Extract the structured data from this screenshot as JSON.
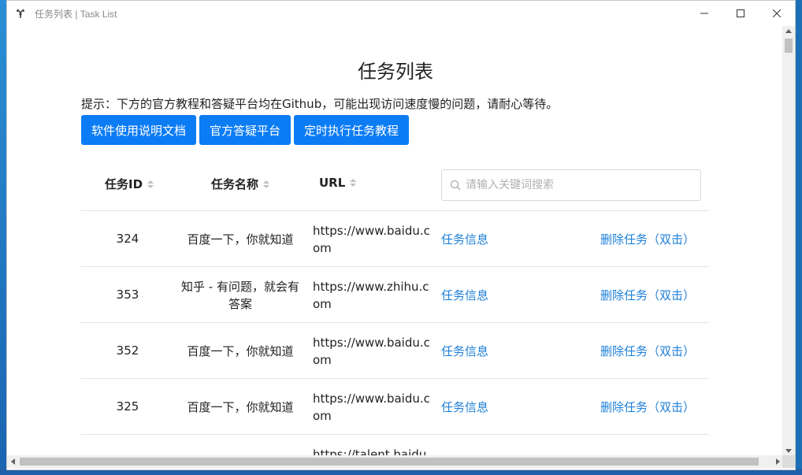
{
  "window": {
    "title": "任务列表 | Task List"
  },
  "page": {
    "title": "任务列表",
    "tip": "提示：下方的官方教程和答疑平台均在Github，可能出现访问速度慢的问题，请耐心等待。",
    "buttons": [
      {
        "label": "软件使用说明文档"
      },
      {
        "label": "官方答疑平台"
      },
      {
        "label": "定时执行任务教程"
      }
    ]
  },
  "table": {
    "columns": {
      "id": "任务ID",
      "name": "任务名称",
      "url": "URL"
    },
    "search_placeholder": "请输入关键词搜索",
    "rows": [
      {
        "id": "324",
        "name": "百度一下，你就知道",
        "url": "https://www.baidu.com",
        "info": "任务信息",
        "delete": "删除任务（双击）"
      },
      {
        "id": "353",
        "name": "知乎 - 有问题，就会有答案",
        "url": "https://www.zhihu.com",
        "info": "任务信息",
        "delete": "删除任务（双击）"
      },
      {
        "id": "352",
        "name": "百度一下，你就知道",
        "url": "https://www.baidu.com",
        "info": "任务信息",
        "delete": "删除任务（双击）"
      },
      {
        "id": "325",
        "name": "百度一下，你就知道",
        "url": "https://www.baidu.com",
        "info": "任务信息",
        "delete": "删除任务（双击）"
      },
      {
        "id": "",
        "name": "",
        "url": "https://talent.baidu",
        "info": "",
        "delete": ""
      }
    ]
  },
  "colors": {
    "primary_button": "#0c7cf5",
    "link": "#1e80d8"
  }
}
